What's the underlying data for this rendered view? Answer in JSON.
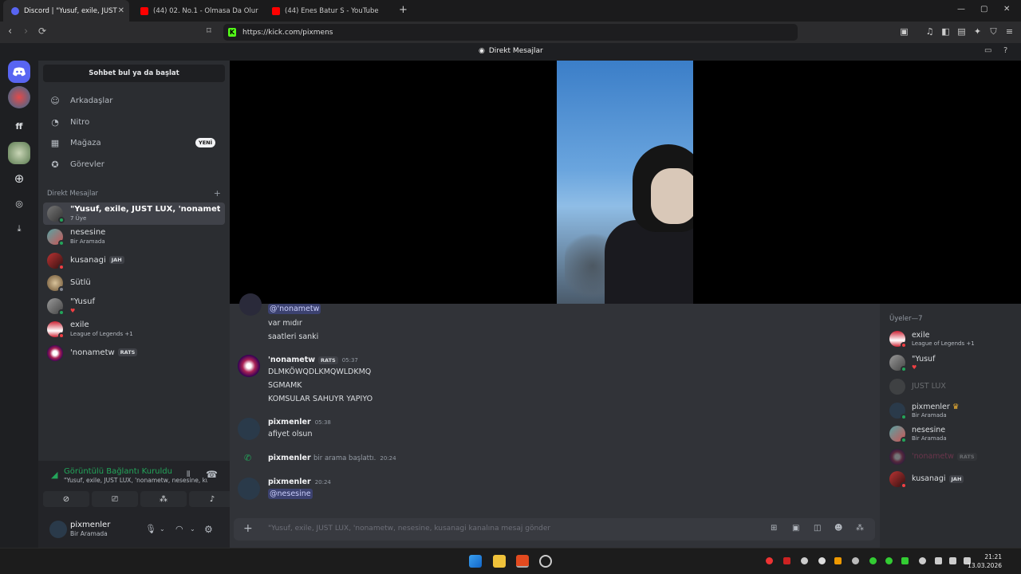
{
  "browser": {
    "tabs": [
      {
        "label": "Discord | \"Yusuf, exile, JUST",
        "active": true
      },
      {
        "label": "(44) 02. No.1 - Olmasa Da Olur (2",
        "active": false
      },
      {
        "label": "(44) Enes Batur S - YouTube",
        "active": false
      }
    ],
    "new_tab": "+",
    "url": "https://kick.com/pixmens",
    "window_controls": [
      "—",
      "▢",
      "✕"
    ]
  },
  "header": {
    "title": "Direkt Mesajlar"
  },
  "sidebar": {
    "search_label": "Sohbet bul ya da başlat",
    "nav": [
      {
        "label": "Arkadaşlar",
        "icon": "friends-icon"
      },
      {
        "label": "Nitro",
        "icon": "nitro-icon"
      },
      {
        "label": "Mağaza",
        "icon": "shop-icon",
        "badge": "YENİ"
      },
      {
        "label": "Görevler",
        "icon": "quests-icon"
      }
    ],
    "dm_header": "Direkt Mesajlar",
    "dms": [
      {
        "name": "\"Yusuf, exile, JUST LUX, 'nonametw, ne...",
        "sub": "7 Üye",
        "active": true
      },
      {
        "name": "nesesine",
        "sub": "Bir Aramada"
      },
      {
        "name": "kusanagi",
        "tag": "JAH"
      },
      {
        "name": "Sütlü"
      },
      {
        "name": "\"Yusuf",
        "sub": "♥"
      },
      {
        "name": "exile",
        "sub": "League of Legends +1"
      },
      {
        "name": "'nonametw",
        "tag": "RATS"
      }
    ]
  },
  "voice": {
    "status": "Görüntülü Bağlantı Kuruldu",
    "channel": "\"Yusuf, exile, JUST LUX, 'nonametw, nesesine, kus..."
  },
  "user": {
    "name": "pixmenler",
    "status": "Bir Aramada"
  },
  "chat": {
    "messages": [
      {
        "lines": [
          "@'nonametw",
          "var mıdır",
          "saatleri sanki"
        ]
      },
      {
        "author": "'nonametw",
        "tag": "RATS",
        "time": "05:37",
        "lines": [
          "DLMKÖWQDLKMQWLDKMQ",
          "SGMAMK",
          "KOMSULAR SAHUYR YAPIYO"
        ]
      },
      {
        "author": "pixmenler",
        "time": "05:38",
        "lines": [
          "afiyet olsun"
        ]
      },
      {
        "author": "pixmenler",
        "system": "bir arama başlattı.",
        "time": "20:24"
      },
      {
        "author": "pixmenler",
        "time": "20:24",
        "lines": [
          "@nesesine"
        ]
      }
    ],
    "composer_placeholder": "\"Yusuf, exile, JUST LUX, 'nonametw, nesesine, kusanagi kanalına mesaj gönder"
  },
  "members": {
    "header": "Üyeler—7",
    "list": [
      {
        "name": "exile",
        "sub": "League of Legends +1"
      },
      {
        "name": "\"Yusuf",
        "sub": "♥"
      },
      {
        "name": "JUST LUX",
        "dim": true
      },
      {
        "name": "pixmenler",
        "crown": "♛",
        "sub": "Bir Aramada"
      },
      {
        "name": "nesesine",
        "sub": "Bir Aramada"
      },
      {
        "name": "'nonametw",
        "tag": "RATS",
        "dim": true
      },
      {
        "name": "kusanagi",
        "tag": "JAH"
      }
    ]
  },
  "taskbar": {
    "time": "21:21",
    "date": "13.03.2026"
  },
  "colors": {
    "accent": "#5865f2",
    "online": "#23a55a",
    "dnd": "#f23f43",
    "mention": "#3c4270"
  }
}
